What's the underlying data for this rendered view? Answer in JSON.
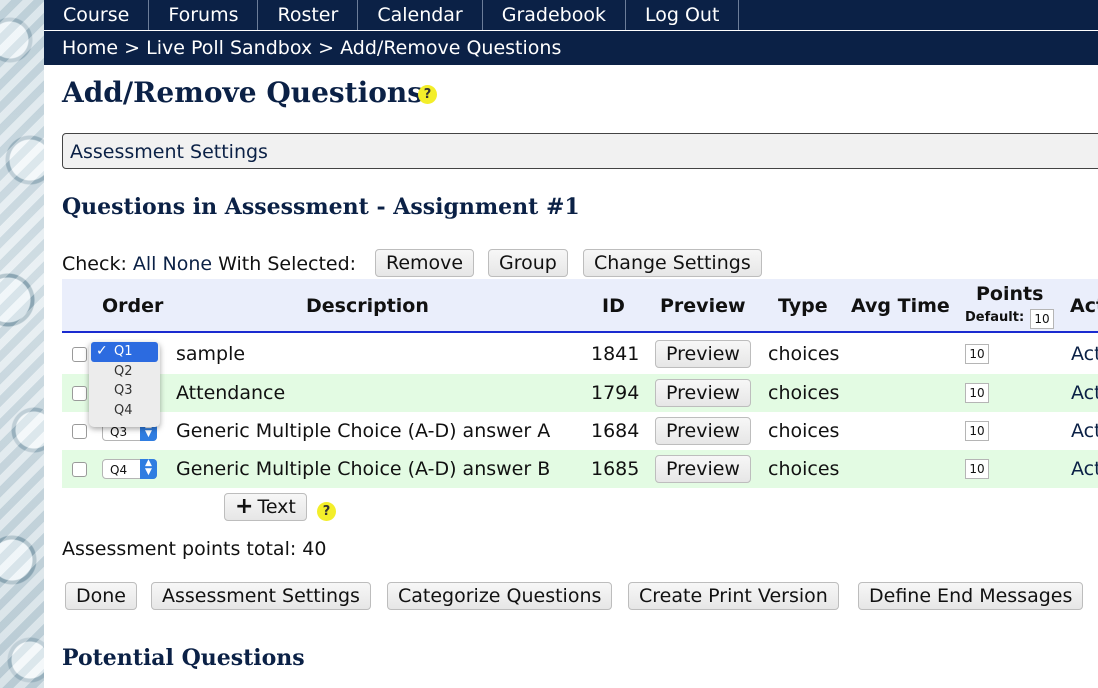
{
  "nav": {
    "items": [
      "Course",
      "Forums",
      "Roster",
      "Calendar",
      "Gradebook",
      "Log Out"
    ]
  },
  "breadcrumb": {
    "items": [
      "Home",
      "Live Poll Sandbox",
      "Add/Remove Questions"
    ],
    "separator": ">"
  },
  "page": {
    "title": "Add/Remove Questions",
    "help_icon": "?",
    "settings_bar": "Assessment Settings",
    "section_title": "Questions in Assessment - Assignment #1"
  },
  "check_bar": {
    "label": "Check:",
    "all": "All",
    "none": "None",
    "with_selected": "With Selected:",
    "remove": "Remove",
    "group": "Group",
    "change_settings": "Change Settings"
  },
  "table": {
    "headers": {
      "order": "Order",
      "description": "Description",
      "id": "ID",
      "preview": "Preview",
      "type": "Type",
      "avg_time": "Avg Time",
      "points": "Points",
      "default_label": "Default:",
      "default_value": "10",
      "actions": "Act"
    },
    "rows": [
      {
        "order": "Q1",
        "description": "sample",
        "id": "1841",
        "preview": "Preview",
        "type": "choices",
        "points": "10",
        "action": "Act"
      },
      {
        "order": "Q2",
        "description": "Attendance",
        "id": "1794",
        "preview": "Preview",
        "type": "choices",
        "points": "10",
        "action": "Act"
      },
      {
        "order": "Q3",
        "description": "Generic Multiple Choice (A-D) answer A",
        "id": "1684",
        "preview": "Preview",
        "type": "choices",
        "points": "10",
        "action": "Act"
      },
      {
        "order": "Q4",
        "description": "Generic Multiple Choice (A-D) answer B",
        "id": "1685",
        "preview": "Preview",
        "type": "choices",
        "points": "10",
        "action": "Act"
      }
    ]
  },
  "order_menu": {
    "options": [
      "Q1",
      "Q2",
      "Q3",
      "Q4"
    ],
    "selected": "Q1",
    "check_mark": "✓"
  },
  "add_text": {
    "plus": "+",
    "label": "Text"
  },
  "points_total": "Assessment points total: 40",
  "bottom_buttons": {
    "done": "Done",
    "assessment_settings": "Assessment Settings",
    "categorize": "Categorize Questions",
    "print": "Create Print Version",
    "end_messages": "Define End Messages"
  },
  "potential": {
    "title": "Potential Questions"
  },
  "colors": {
    "nav_bg": "#0b2146",
    "header_bg": "#eaeefb",
    "alt_row": "#e3fbe3",
    "help_yellow": "#f3ee2a",
    "menu_select": "#2c6be0"
  }
}
